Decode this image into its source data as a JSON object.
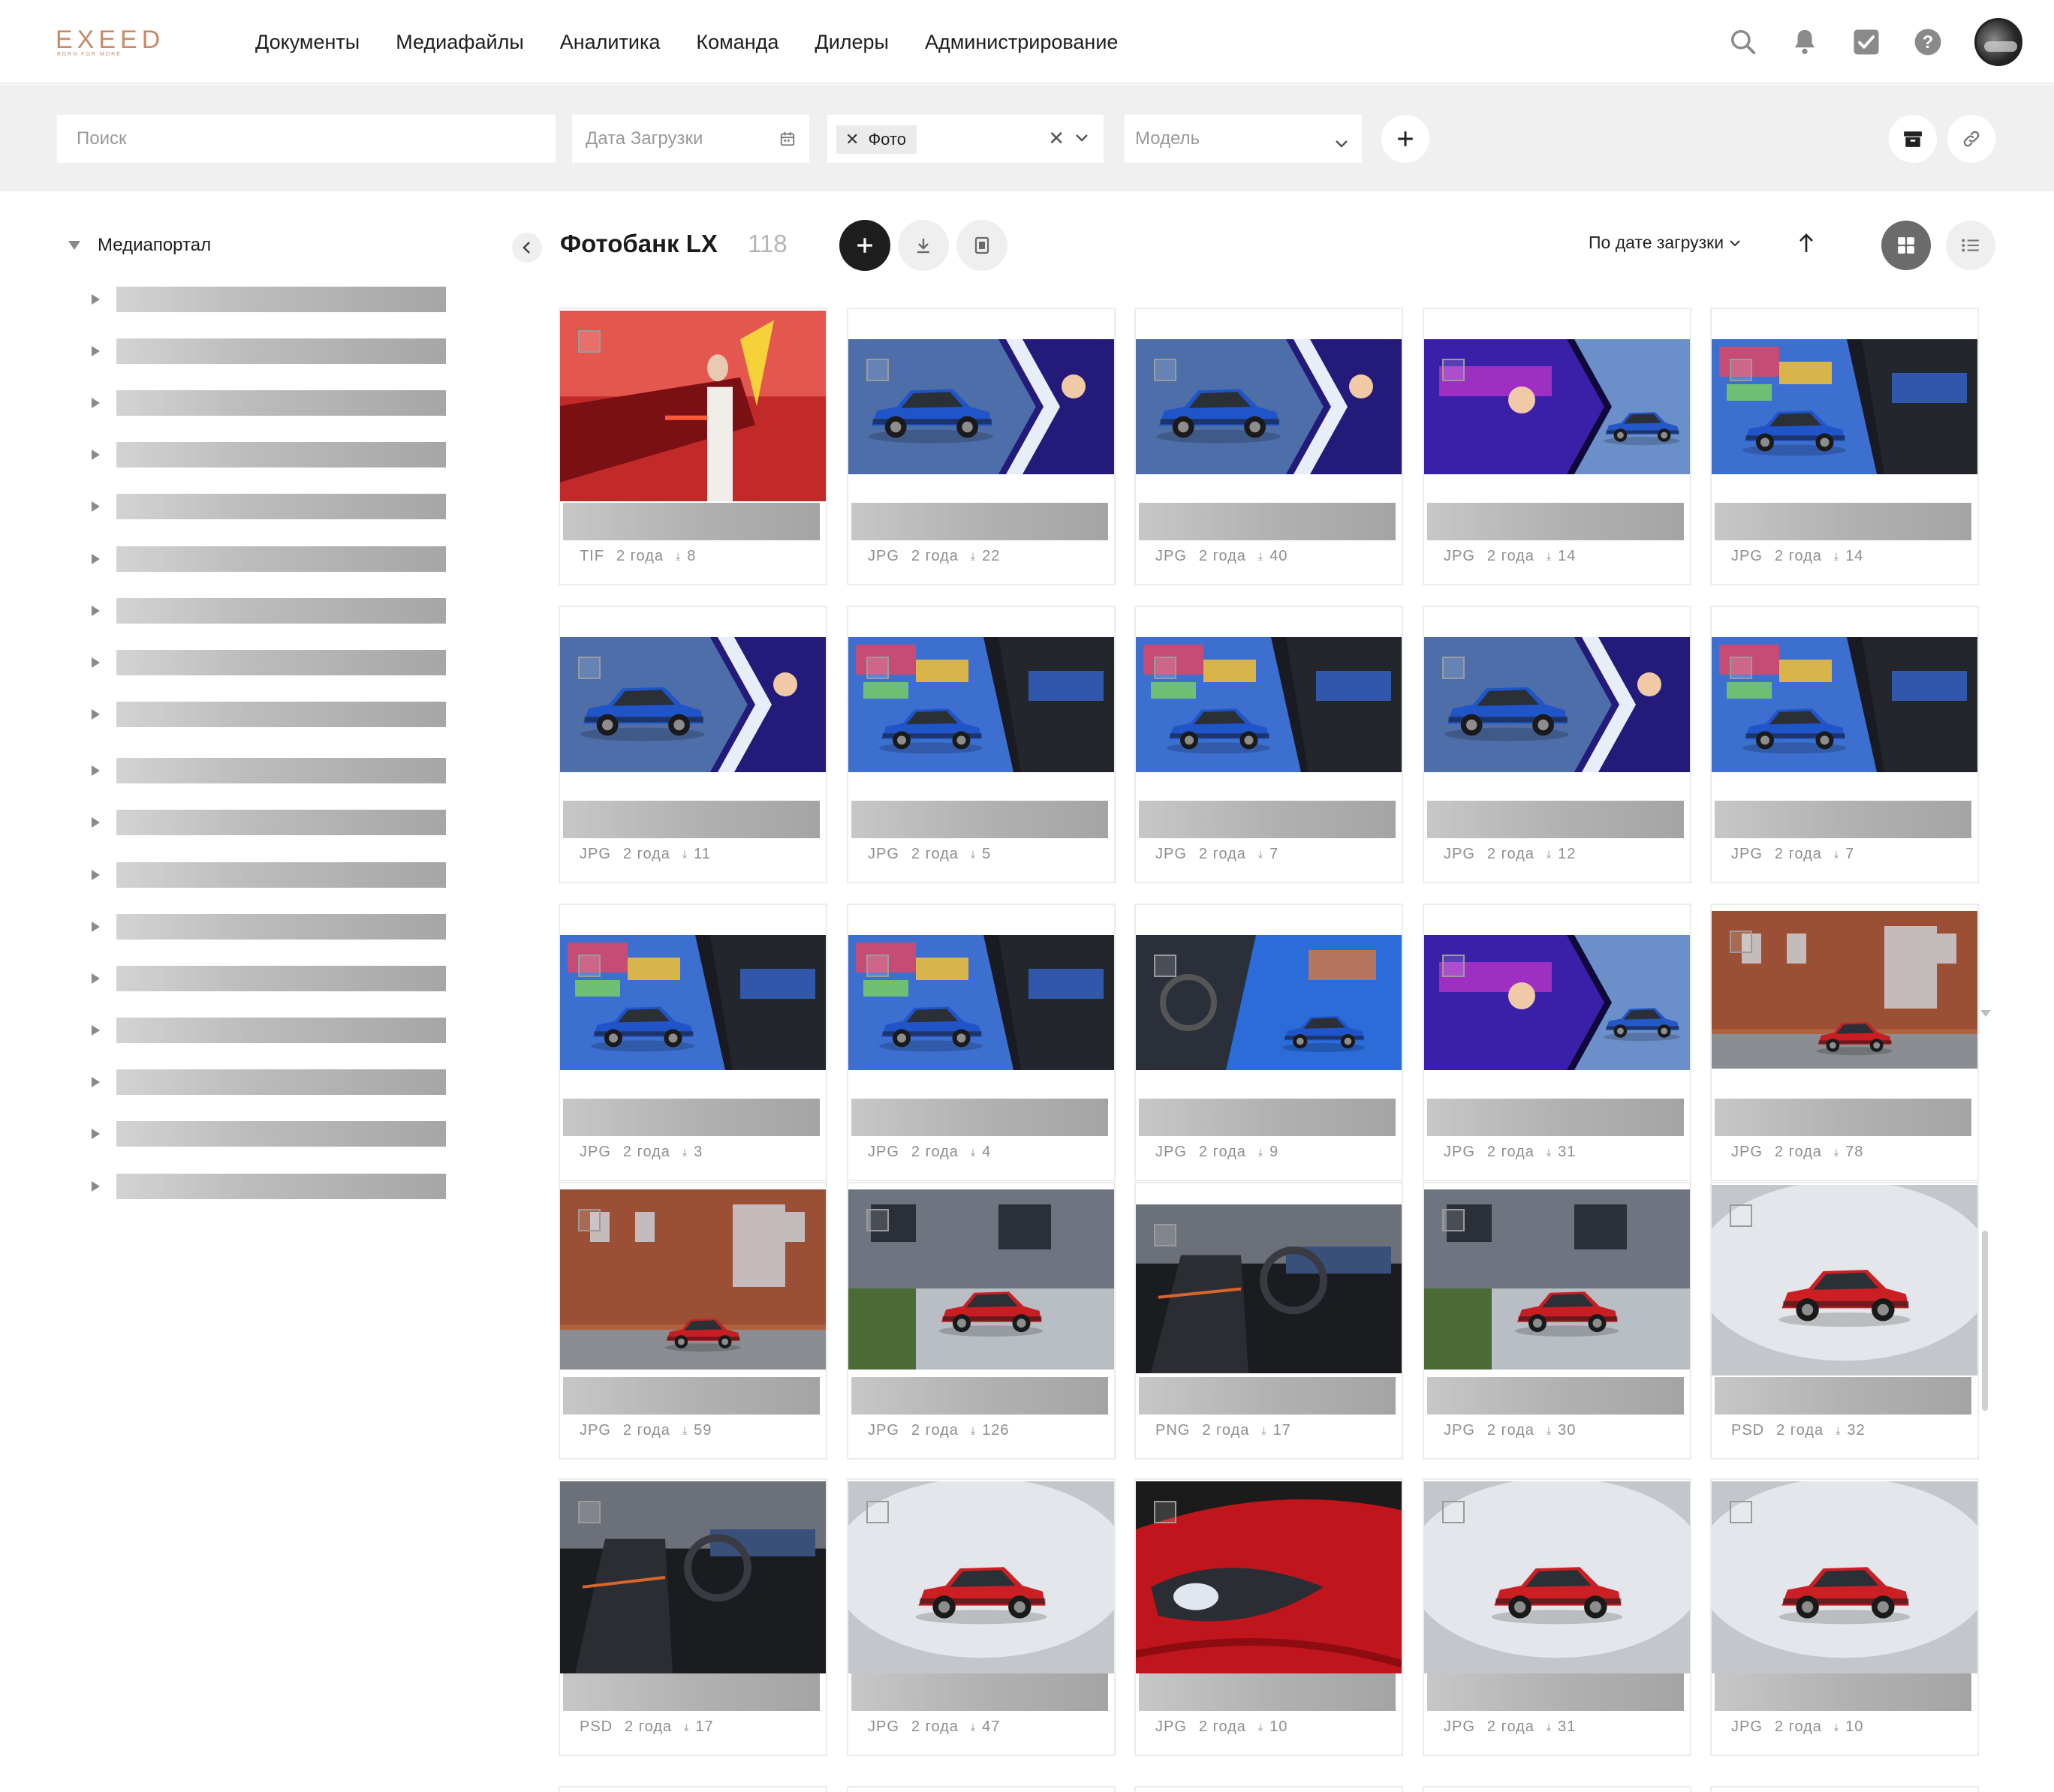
{
  "brand": {
    "name": "EXEED",
    "tagline": "BORN FOR MORE",
    "accent": "#c98a6c"
  },
  "nav": {
    "items": [
      "Документы",
      "Медиафайлы",
      "Аналитика",
      "Команда",
      "Дилеры",
      "Администрирование"
    ]
  },
  "top_icons": [
    "search-icon",
    "bell-icon",
    "checkbox-icon",
    "help-icon"
  ],
  "filters": {
    "search_placeholder": "Поиск",
    "date_placeholder": "Дата Загрузки",
    "type_chip": "Фото",
    "model_placeholder": "Модель"
  },
  "tree": {
    "root_label": "Медиапортал",
    "collapsed_items": 18
  },
  "content": {
    "title": "Фотобанк LX",
    "count": "118",
    "sort_label": "По дате загрузки"
  },
  "cards": [
    {
      "ext": "TIF",
      "age": "2 года",
      "downloads": "8",
      "theme": "red-fashion"
    },
    {
      "ext": "JPG",
      "age": "2 года",
      "downloads": "22",
      "theme": "blue-collage"
    },
    {
      "ext": "JPG",
      "age": "2 года",
      "downloads": "40",
      "theme": "blue-collage"
    },
    {
      "ext": "JPG",
      "age": "2 года",
      "downloads": "14",
      "theme": "neon-collage"
    },
    {
      "ext": "JPG",
      "age": "2 года",
      "downloads": "14",
      "theme": "graffiti-collage"
    },
    {
      "ext": "JPG",
      "age": "2 года",
      "downloads": "11",
      "theme": "blue-collage"
    },
    {
      "ext": "JPG",
      "age": "2 года",
      "downloads": "5",
      "theme": "graffiti-collage"
    },
    {
      "ext": "JPG",
      "age": "2 года",
      "downloads": "7",
      "theme": "graffiti-collage"
    },
    {
      "ext": "JPG",
      "age": "2 года",
      "downloads": "12",
      "theme": "blue-collage"
    },
    {
      "ext": "JPG",
      "age": "2 года",
      "downloads": "7",
      "theme": "graffiti-collage"
    },
    {
      "ext": "JPG",
      "age": "2 года",
      "downloads": "3",
      "theme": "graffiti-collage"
    },
    {
      "ext": "JPG",
      "age": "2 года",
      "downloads": "4",
      "theme": "graffiti-collage"
    },
    {
      "ext": "JPG",
      "age": "2 года",
      "downloads": "9",
      "theme": "interior-collage"
    },
    {
      "ext": "JPG",
      "age": "2 года",
      "downloads": "31",
      "theme": "neon-collage"
    },
    {
      "ext": "JPG",
      "age": "2 года",
      "downloads": "78",
      "theme": "brick-red"
    },
    {
      "ext": "JPG",
      "age": "2 года",
      "downloads": "59",
      "theme": "brick-red"
    },
    {
      "ext": "JPG",
      "age": "2 года",
      "downloads": "126",
      "theme": "street-red"
    },
    {
      "ext": "PNG",
      "age": "2 года",
      "downloads": "17",
      "theme": "interior-dark"
    },
    {
      "ext": "JPG",
      "age": "2 года",
      "downloads": "30",
      "theme": "street-red"
    },
    {
      "ext": "PSD",
      "age": "2 года",
      "downloads": "32",
      "theme": "studio-red"
    },
    {
      "ext": "PSD",
      "age": "2 года",
      "downloads": "17",
      "theme": "interior-dark"
    },
    {
      "ext": "JPG",
      "age": "2 года",
      "downloads": "47",
      "theme": "studio-red"
    },
    {
      "ext": "JPG",
      "age": "2 года",
      "downloads": "10",
      "theme": "headlight-red"
    },
    {
      "ext": "JPG",
      "age": "2 года",
      "downloads": "31",
      "theme": "studio-red"
    },
    {
      "ext": "JPG",
      "age": "2 года",
      "downloads": "10",
      "theme": "studio-red"
    }
  ]
}
